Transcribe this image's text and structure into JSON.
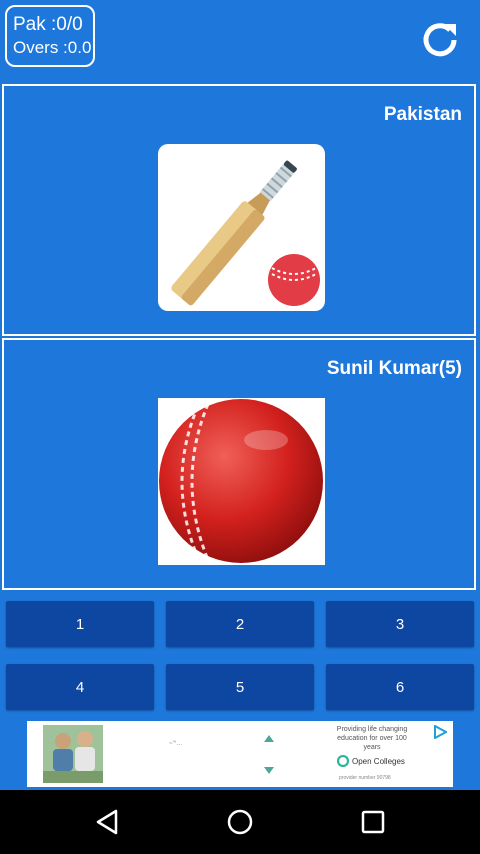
{
  "score": {
    "runs_line": "Pak :0/0",
    "overs_line": "Overs :0.0"
  },
  "batting_panel": {
    "team_name": "Pakistan",
    "icon": "cricket-bat-and-ball-icon"
  },
  "bowling_panel": {
    "bowler_name": "Sunil Kumar(5)",
    "icon": "cricket-ball-icon"
  },
  "run_buttons": [
    "1",
    "2",
    "3",
    "4",
    "5",
    "6"
  ],
  "ad": {
    "headline": "Providing life changing education for over 100 years",
    "brand": "Open Colleges",
    "provider": "provider number 90798",
    "tiny_text": "~’°…"
  },
  "colors": {
    "background": "#1e78dc",
    "button": "#0d47a1",
    "ball_red": "#d3211e",
    "navbar": "#000000"
  },
  "icons": {
    "refresh": "refresh-icon",
    "nav_back": "back-triangle-icon",
    "nav_home": "home-circle-icon",
    "nav_recents": "recents-square-icon",
    "ad_choices": "ad-choices-icon"
  }
}
